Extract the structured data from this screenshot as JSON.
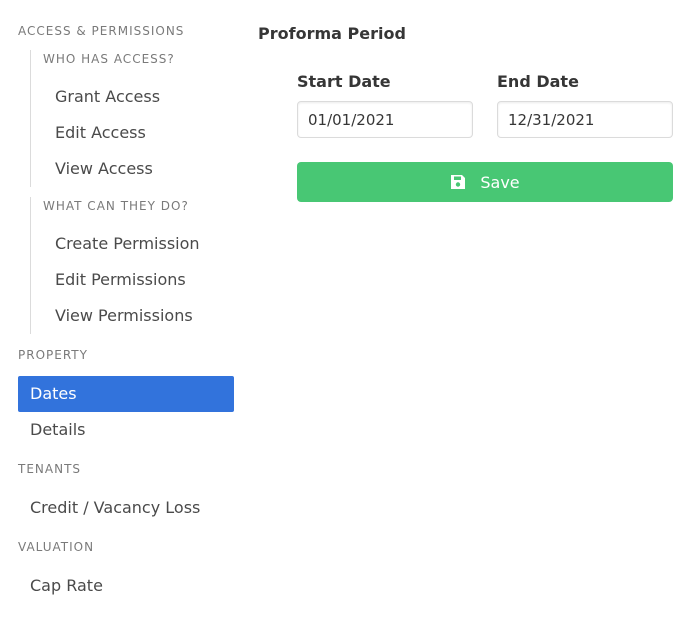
{
  "sidebar": {
    "access_permissions": {
      "label": "ACCESS & PERMISSIONS",
      "who_has_access": {
        "label": "WHO HAS ACCESS?",
        "items": [
          "Grant Access",
          "Edit Access",
          "View Access"
        ]
      },
      "what_can_they_do": {
        "label": "WHAT CAN THEY DO?",
        "items": [
          "Create Permission",
          "Edit Permissions",
          "View Permissions"
        ]
      }
    },
    "property": {
      "label": "PROPERTY",
      "items": [
        "Dates",
        "Details"
      ],
      "active_item": "Dates"
    },
    "tenants": {
      "label": "TENANTS",
      "items": [
        "Credit / Vacancy Loss"
      ]
    },
    "valuation": {
      "label": "VALUATION",
      "items": [
        "Cap Rate"
      ]
    }
  },
  "main": {
    "title": "Proforma Period",
    "start_date": {
      "label": "Start Date",
      "value": "01/01/2021"
    },
    "end_date": {
      "label": "End Date",
      "value": "12/31/2021"
    },
    "save_button": {
      "label": "Save",
      "icon": "floppy-disk-icon"
    }
  },
  "colors": {
    "accent": "#3273dc",
    "success": "#48c774",
    "muted_text": "#7a7a7a"
  }
}
